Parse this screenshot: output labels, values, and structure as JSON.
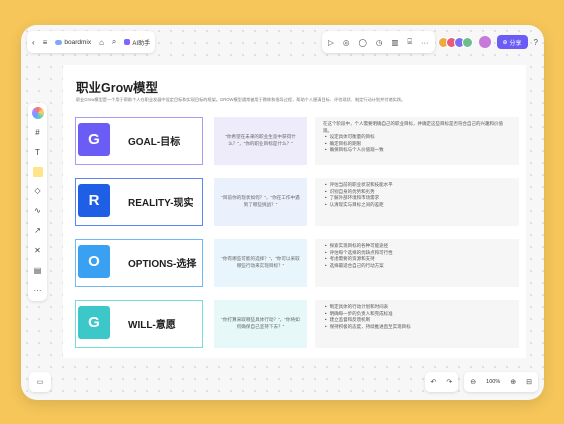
{
  "toolbar": {
    "brand": "boardmix",
    "ai_label": "AI助手",
    "share_label": "分享",
    "icons_left": [
      "chevron-left-icon",
      "menu-icon",
      "tag-icon",
      "search-icon"
    ],
    "icons_right": [
      "play-icon",
      "sticky-icon",
      "comment-icon",
      "timer-icon",
      "chart-icon",
      "present-icon",
      "more-icon"
    ],
    "avatar_colors": [
      "#f4a640",
      "#e85b7a",
      "#7a6ff0",
      "#6bbf8a"
    ]
  },
  "left_tools": [
    "select-icon",
    "frame-icon",
    "text-icon",
    "sticky-note-icon",
    "shape-icon",
    "pen-icon",
    "connector-icon",
    "mindmap-icon",
    "template-icon",
    "more-icon"
  ],
  "canvas": {
    "title": "职业Grow模型",
    "subtitle": "职业Grow模型是一个用于帮助个人在职业发展中设定目标和实现目标的框架。GROW模型通常被用于教练和指导过程，帮助个人厘清目标、评估现状、制定行动计划并付诸实践。"
  },
  "rows": [
    {
      "letter": "G",
      "name": "GOAL-目标",
      "color": "#6b5cf6",
      "border": "#a99cf7",
      "qbg": "#eeecfb",
      "question": "\"你希望在未来的职业生涯中获得什么？\"，\"你的职业目标是什么？\"",
      "desc_intro": "在这个阶段中，个人需要明确自己的职业目标，并确定这些目标是否符合自己的兴趣和价值观。",
      "bullets": [
        "设定具体可衡量的目标",
        "确定目标的期限",
        "确保目标与个人价值观一致"
      ]
    },
    {
      "letter": "R",
      "name": "REALITY-现实",
      "color": "#1f5fe6",
      "border": "#5e86f0",
      "qbg": "#eaf1fd",
      "question": "\"目前你的现状如何？\"，\"你在工作中遇到了哪些挑战？\"",
      "desc_intro": "",
      "bullets": [
        "评估当前的职业状况和技能水平",
        "识别自身的优势和劣势",
        "了解外部环境和市场需求",
        "认清现实与目标之间的差距"
      ]
    },
    {
      "letter": "O",
      "name": "OPTIONS-选择",
      "color": "#3aa0f2",
      "border": "#6fbaf5",
      "qbg": "#e8f5fd",
      "question": "\"你有哪些可能的选择？\"，\"你可以采取哪些行动来实现目标？\"",
      "desc_intro": "",
      "bullets": [
        "探索实现目标的各种可能途径",
        "评估每个选择的优缺点和可行性",
        "考虑需要的资源和支持",
        "选择最适合自己的行动方案"
      ]
    },
    {
      "letter": "G",
      "name": "WILL-意愿",
      "color": "#3cc8c8",
      "border": "#79dcdc",
      "qbg": "#e6f8f8",
      "question": "\"你打算采取哪些具体行动？\"，\"你将如何确保自己坚持下去？\"",
      "desc_intro": "",
      "bullets": [
        "制定具体的行动计划和时间表",
        "明确每一步的负责人和完成标准",
        "建立监督和反馈机制",
        "保持积极的态度，持续推进直至实现目标"
      ]
    }
  ],
  "bottom": {
    "zoom": "100%"
  }
}
